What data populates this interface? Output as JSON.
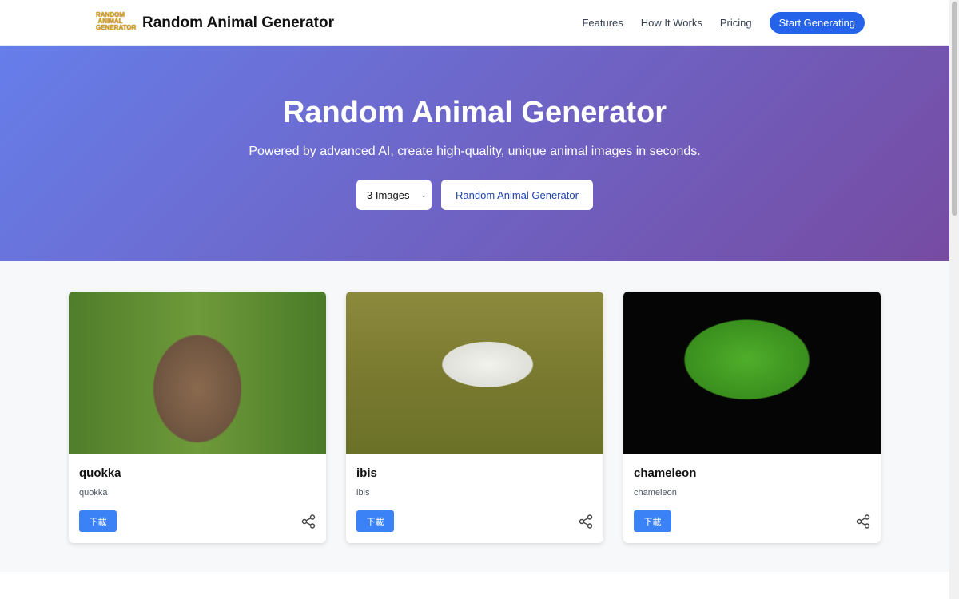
{
  "nav": {
    "logo_text": "RANDOM ANIMAL GENERATOR",
    "brand": "Random Animal Generator",
    "links": [
      "Features",
      "How It Works",
      "Pricing"
    ],
    "cta": "Start Generating"
  },
  "hero": {
    "title": "Random Animal Generator",
    "subtitle": "Powered by advanced AI, create high-quality, unique animal images in seconds.",
    "select_value": "3 Images",
    "generate_label": "Random Animal Generator"
  },
  "cards": [
    {
      "title": "quokka",
      "subtitle": "quokka",
      "download": "下載",
      "icon": "share-icon"
    },
    {
      "title": "ibis",
      "subtitle": "ibis",
      "download": "下載",
      "icon": "share-icon"
    },
    {
      "title": "chameleon",
      "subtitle": "chameleon",
      "download": "下載",
      "icon": "share-icon"
    }
  ],
  "colors": {
    "primary": "#2563eb",
    "hero_start": "#667eea",
    "hero_end": "#764ba2",
    "button": "#3b82f6"
  }
}
